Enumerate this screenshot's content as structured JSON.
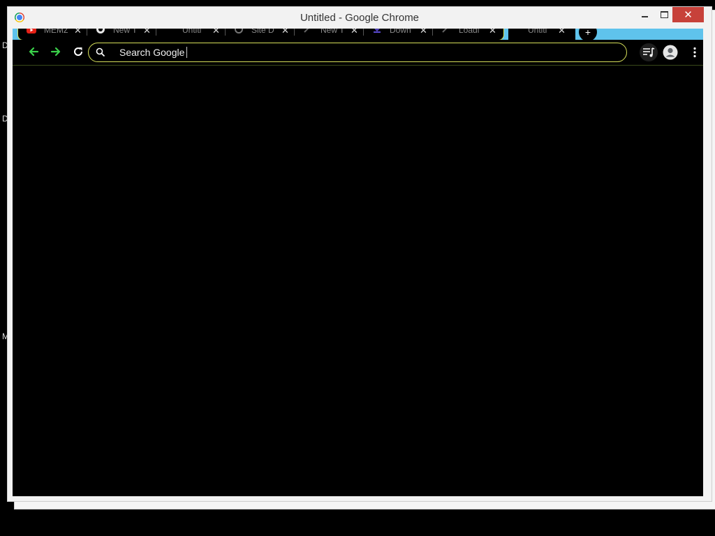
{
  "desktop": {
    "letters": [
      "D",
      "D",
      "M"
    ]
  },
  "window": {
    "title": "Untitled - Google Chrome",
    "close_glyph": "✕"
  },
  "tabs": [
    {
      "title": "MEMZ",
      "icon": "youtube-icon"
    },
    {
      "title": "New T",
      "icon": "github-icon"
    },
    {
      "title": "Untitl",
      "icon": "blank-icon"
    },
    {
      "title": "Site D",
      "icon": "globe-icon"
    },
    {
      "title": "New T",
      "icon": "link-icon"
    },
    {
      "title": "Down",
      "icon": "download-icon"
    },
    {
      "title": "Loadi",
      "icon": "link-icon"
    },
    {
      "title": "Untitl",
      "icon": "blank-icon"
    }
  ],
  "tab_close_glyph": "✕",
  "new_tab_glyph": "+",
  "omnibox": {
    "placeholder": "Search Google"
  },
  "colors": {
    "accent_green": "#3ad14a",
    "tabstrip_blue": "#5fc3ec",
    "omnibox_border": "#d7e05a",
    "close_red": "#c7413a"
  }
}
